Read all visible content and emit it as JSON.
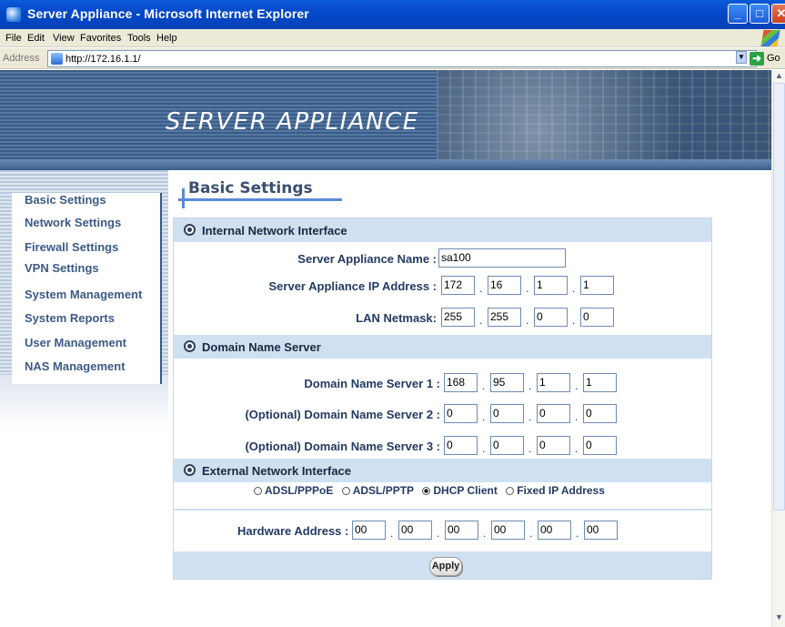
{
  "window": {
    "title": "Server Appliance - Microsoft Internet Explorer"
  },
  "menu": [
    "File",
    "Edit",
    "View",
    "Favorites",
    "Tools",
    "Help"
  ],
  "address": {
    "label": "Address",
    "url": "http://172.16.1.1/",
    "go_label": "Go"
  },
  "banner": {
    "title": "SERVER APPLIANCE"
  },
  "sidebar": {
    "items": [
      {
        "label": "Basic Settings"
      },
      {
        "label": "Network Settings"
      },
      {
        "label": "Firewall Settings"
      },
      {
        "label": "VPN Settings"
      },
      {
        "label": "System Management"
      },
      {
        "label": "System Reports"
      },
      {
        "label": "User Management"
      },
      {
        "label": "NAS Management"
      }
    ]
  },
  "page": {
    "heading": "Basic Settings"
  },
  "internal": {
    "title": "Internal Network Interface",
    "name_label": "Server Appliance Name :",
    "name_value": "sa100",
    "ip_label": "Server Appliance IP Address :",
    "ip": [
      "172",
      "16",
      "1",
      "1"
    ],
    "mask_label": "LAN Netmask:",
    "mask": [
      "255",
      "255",
      "0",
      "0"
    ]
  },
  "dns": {
    "title": "Domain Name Server",
    "dns1_label": "Domain Name Server 1 :",
    "dns1": [
      "168",
      "95",
      "1",
      "1"
    ],
    "dns2_label": "(Optional) Domain Name Server 2 :",
    "dns2": [
      "0",
      "0",
      "0",
      "0"
    ],
    "dns3_label": "(Optional) Domain Name Server 3 :",
    "dns3": [
      "0",
      "0",
      "0",
      "0"
    ]
  },
  "external": {
    "title": "External Network Interface",
    "options": [
      {
        "label": "ADSL/PPPoE",
        "selected": false
      },
      {
        "label": "ADSL/PPTP",
        "selected": false
      },
      {
        "label": "DHCP Client",
        "selected": true
      },
      {
        "label": "Fixed IP Address",
        "selected": false
      }
    ],
    "hw_label": "Hardware Address :",
    "hw": [
      "00",
      "00",
      "00",
      "00",
      "00",
      "00"
    ]
  },
  "actions": {
    "apply_label": "Apply"
  }
}
